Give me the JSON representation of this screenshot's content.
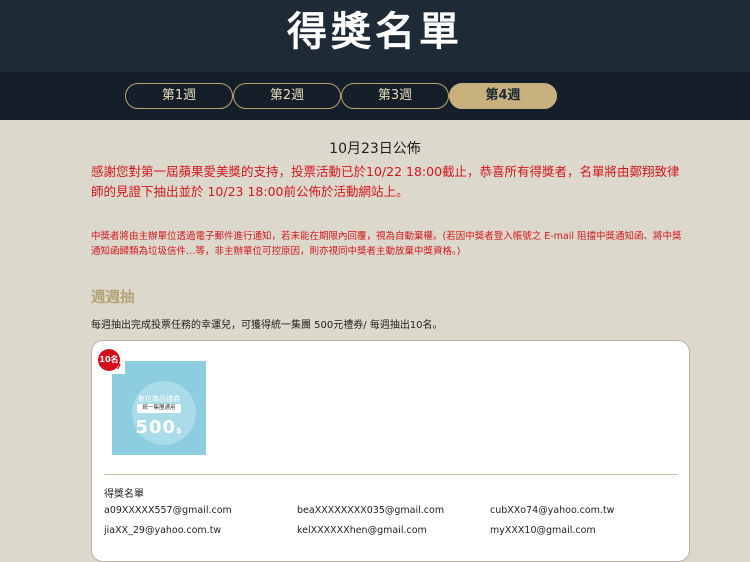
{
  "header": {
    "title": "得獎名單"
  },
  "tabs": [
    {
      "label": "第1週",
      "active": false
    },
    {
      "label": "第2週",
      "active": false
    },
    {
      "label": "第3週",
      "active": false
    },
    {
      "label": "第4週",
      "active": true
    }
  ],
  "announcement": {
    "date": "10月23日公佈",
    "message": "感謝您對第一屆蘋果愛美獎的支持，投票活動已於10/22 18:00截止，恭喜所有得獎者，名單將由鄭翔致律師的見證下抽出並於 10/23 18:00前公佈於活動網站上。",
    "notice": "中獎者將由主辦單位透過電子郵件進行通知，若未能在期限內回覆，視為自動棄權。(若因中獎者登入帳號之 E-mail 阻擋中獎通知函、將中獎通知函歸類為垃圾信件…等，非主辦單位可控原因，則亦視同中獎者主動放棄中獎資格。)"
  },
  "section": {
    "title": "週週抽",
    "description": "每週抽出完成投票任務的幸運兒，可獲得統一集團 500元禮券/ 每週抽出10名。"
  },
  "prize_card": {
    "quantity_badge": "10名",
    "voucher": {
      "title": "數位商品禮券",
      "subtitle": "統一集團通用",
      "amount": "500",
      "currency": "$"
    },
    "winners_title": "得獎名單",
    "winners": [
      "a09XXXXX557@gmail.com",
      "beaXXXXXXXX035@gmail.com",
      "cubXXo74@yahoo.com.tw",
      "jiaXX_29@yahoo.com.tw",
      "kelXXXXXXhen@gmail.com",
      "myXXX10@gmail.com"
    ]
  },
  "colors": {
    "header_bg": "#1e2b36",
    "tabbar_bg": "#141f29",
    "page_bg": "#ddd8cc",
    "accent_gold": "#c8b17c",
    "alert_red": "#d4161d"
  }
}
